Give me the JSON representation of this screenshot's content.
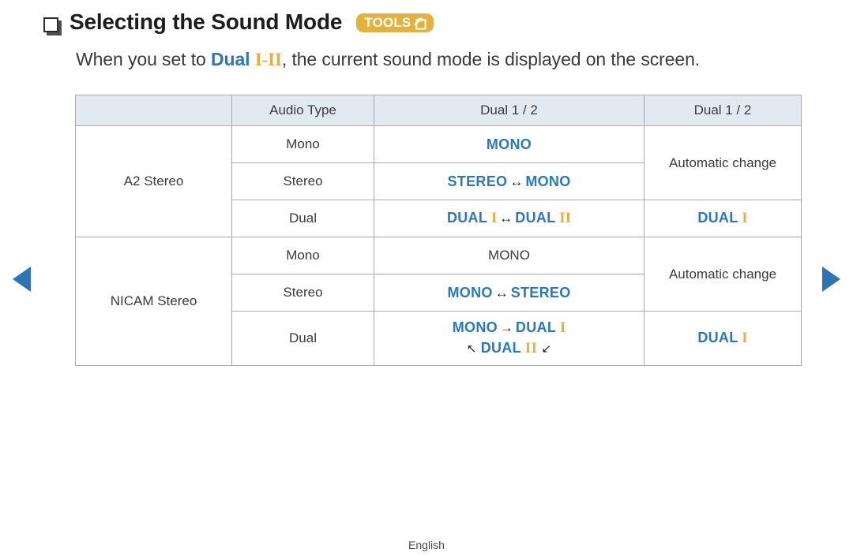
{
  "heading": {
    "bullet_icon": "square-bullet-icon",
    "title": "Selecting the Sound Mode",
    "badge_label": "TOOLS",
    "badge_icon": "tools-arrow-icon",
    "badge_bg": "#e4b13e"
  },
  "intro": {
    "part1": "When you set to ",
    "keyword": "Dual",
    "numeral_one": "I",
    "dash": "-",
    "numeral_two": "II",
    "part2": ", the current sound mode is displayed on the screen."
  },
  "colors": {
    "accent_blue": "#2878c0",
    "accent_gold": "#e4b13e",
    "nav_blue": "#2d74b5",
    "header_bg": "#e2eaf1",
    "border": "#a9a9a9",
    "text": "#3a3a3a"
  },
  "table": {
    "headers": {
      "group": "",
      "audio_type": "Audio Type",
      "dual_a": "Dual 1 / 2",
      "dual_b": "Dual 1 / 2"
    },
    "groups": [
      {
        "name": "A2 Stereo",
        "rows": [
          {
            "audio_type": "Mono",
            "dual_a": {
              "left": "MONO",
              "style": "blue"
            },
            "dual_b": {
              "text": "Automatic change",
              "style": "plain",
              "rowspan": 2
            }
          },
          {
            "audio_type": "Stereo",
            "dual_a": {
              "left": "STEREO",
              "arrow": "↔",
              "right": "MONO",
              "style": "blue"
            }
          },
          {
            "audio_type": "Dual",
            "dual_a": {
              "left": "DUAL",
              "left_numeral": "I",
              "arrow": "↔",
              "right": "DUAL",
              "right_numeral": "II",
              "style": "blue"
            },
            "dual_b": {
              "text": "DUAL",
              "numeral": "I",
              "style": "blue"
            }
          }
        ]
      },
      {
        "name": "NICAM Stereo",
        "rows": [
          {
            "audio_type": "Mono",
            "dual_a": {
              "left": "MONO",
              "style": "plain"
            },
            "dual_b": {
              "text": "Automatic change",
              "style": "plain",
              "rowspan": 2
            }
          },
          {
            "audio_type": "Stereo",
            "dual_a": {
              "left": "MONO",
              "arrow": "↔",
              "right": "STEREO",
              "style": "blue"
            }
          },
          {
            "audio_type": "Dual",
            "dual_a": {
              "line1_left": "MONO",
              "line1_arrow": "→",
              "line1_right": "DUAL",
              "line1_numeral": "I",
              "line2_arrow_left": "↖",
              "line2_text": "DUAL",
              "line2_numeral": "II",
              "line2_arrow_right": "↙",
              "style": "blue"
            },
            "dual_b": {
              "text": "DUAL",
              "numeral": "I",
              "style": "blue"
            }
          }
        ]
      }
    ]
  },
  "navigation": {
    "prev_icon": "triangle-left-icon",
    "next_icon": "triangle-right-icon"
  },
  "footer": {
    "language": "English"
  }
}
